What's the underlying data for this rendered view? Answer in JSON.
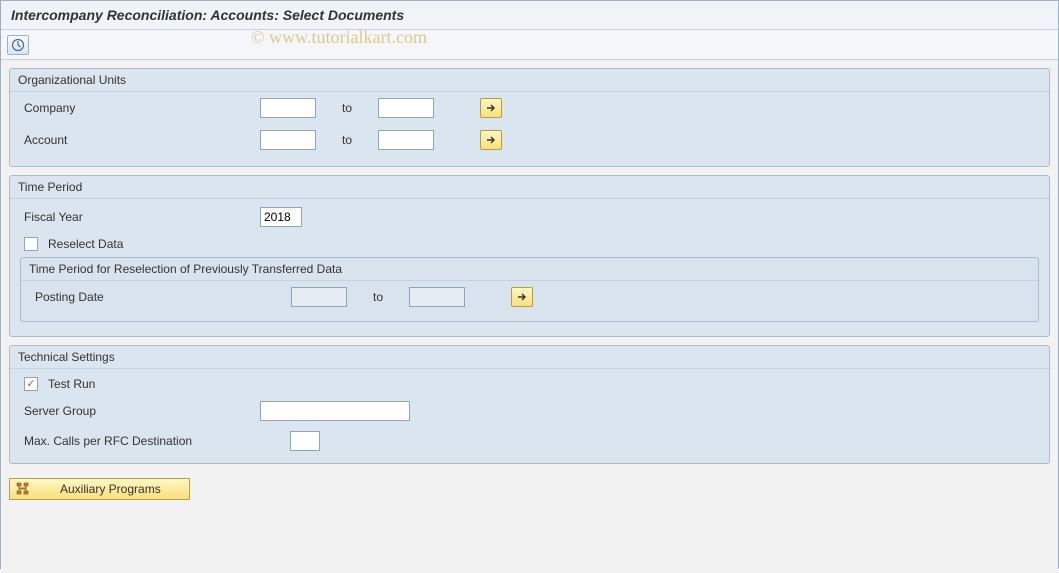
{
  "title": "Intercompany Reconciliation: Accounts: Select Documents",
  "watermark": "© www.tutorialkart.com",
  "toolbar": {
    "execute_icon": "execute-icon"
  },
  "org_units": {
    "title": "Organizational Units",
    "company_label": "Company",
    "company_from": "",
    "company_to_label": "to",
    "company_to": "",
    "account_label": "Account",
    "account_from": "",
    "account_to_label": "to",
    "account_to": ""
  },
  "time_period": {
    "title": "Time Period",
    "fiscal_year_label": "Fiscal Year",
    "fiscal_year": "2018",
    "reselect_label": "Reselect Data",
    "reselect_checked": false,
    "nested_title": "Time Period for Reselection of Previously Transferred Data",
    "posting_date_label": "Posting Date",
    "posting_date_from": "",
    "posting_date_to_label": "to",
    "posting_date_to": ""
  },
  "tech_settings": {
    "title": "Technical Settings",
    "test_run_label": "Test Run",
    "test_run_checked": true,
    "server_group_label": "Server Group",
    "server_group": "",
    "max_calls_label": "Max. Calls per RFC Destination",
    "max_calls": ""
  },
  "aux_button": {
    "label": "Auxiliary Programs"
  }
}
